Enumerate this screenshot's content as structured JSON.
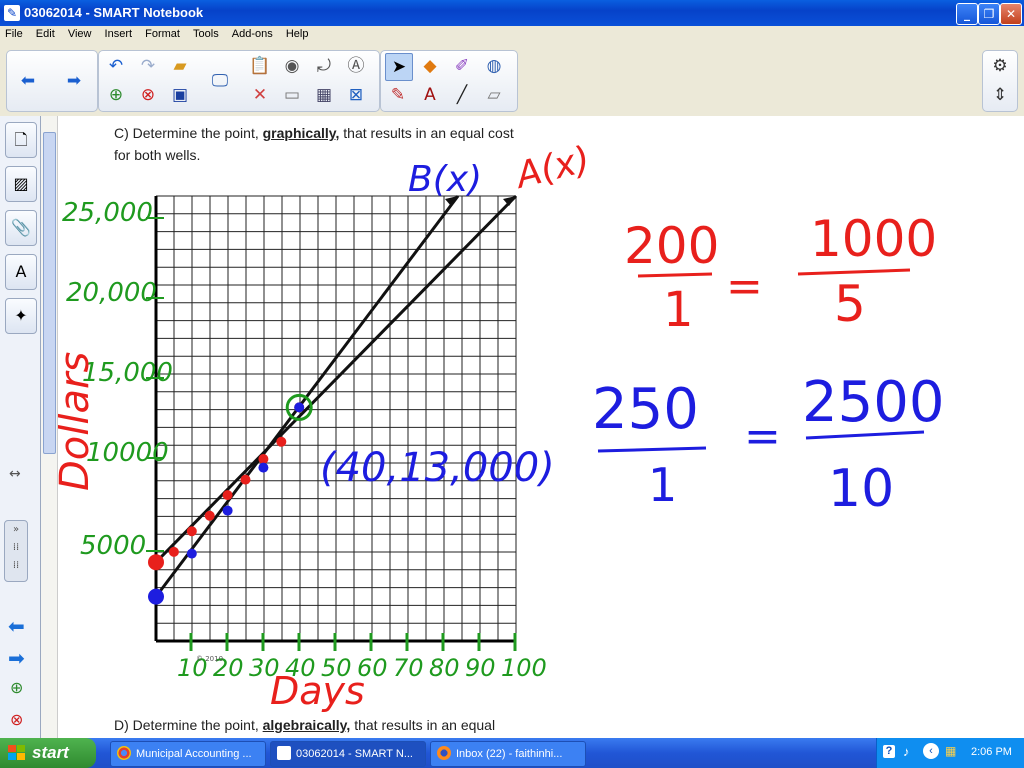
{
  "window": {
    "title": "03062014 - SMART Notebook"
  },
  "menu": [
    "File",
    "Edit",
    "View",
    "Insert",
    "Format",
    "Tools",
    "Add-ons",
    "Help"
  ],
  "page": {
    "question_c_line1": "C) Determine the point, ",
    "question_c_bold": "graphically,",
    "question_c_line1b": " that results in an equal cost",
    "question_c_line2": "for both wells.",
    "question_d_pre": "D) Determine the point, ",
    "question_d_bold": "algebraically,",
    "question_d_post": " that results in an equal",
    "copyright": "© 2010"
  },
  "ink": {
    "y_axis_title": "Dollars",
    "x_axis_title": "Days",
    "y_ticks": [
      "25,000",
      "20,000",
      "15,000",
      "10000",
      "5000"
    ],
    "x_ticks": [
      "10",
      "20",
      "30",
      "40",
      "50",
      "60",
      "70",
      "80",
      "90",
      "100"
    ],
    "label_b": "B(x)",
    "label_a": "A(x)",
    "intersection": "(40,13,000)",
    "ratio_red_num1": "200",
    "ratio_red_den1": "1",
    "ratio_red_num2": "1000",
    "ratio_red_den2": "5",
    "ratio_blue_num1": "250",
    "ratio_blue_den1": "1",
    "ratio_blue_num2": "2500",
    "ratio_blue_den2": "10",
    "equals": "=",
    "colors": {
      "red": "#e8201c",
      "blue": "#1d1ddf",
      "green": "#1f9a1f",
      "black": "#111111"
    }
  },
  "chart_data": {
    "type": "line",
    "xlabel": "Days",
    "ylabel": "Dollars",
    "xlim": [
      0,
      100
    ],
    "ylim": [
      0,
      25000
    ],
    "series": [
      {
        "name": "A(x)",
        "color": "red",
        "points": [
          [
            0,
            4000
          ],
          [
            5,
            4600
          ],
          [
            10,
            5800
          ],
          [
            15,
            6700
          ],
          [
            20,
            7900
          ],
          [
            25,
            8800
          ],
          [
            30,
            10000
          ],
          [
            35,
            11000
          ],
          [
            40,
            13000
          ]
        ]
      },
      {
        "name": "B(x)",
        "color": "blue",
        "points": [
          [
            0,
            2000
          ],
          [
            10,
            4500
          ],
          [
            20,
            7000
          ],
          [
            30,
            9500
          ],
          [
            40,
            13000
          ]
        ]
      }
    ],
    "intersection": [
      40,
      13000
    ]
  },
  "taskbar": {
    "start": "start",
    "tasks": [
      "Municipal Accounting ...",
      "03062014 - SMART N...",
      "Inbox (22) - faithinhi..."
    ],
    "clock": "2:06 PM"
  }
}
